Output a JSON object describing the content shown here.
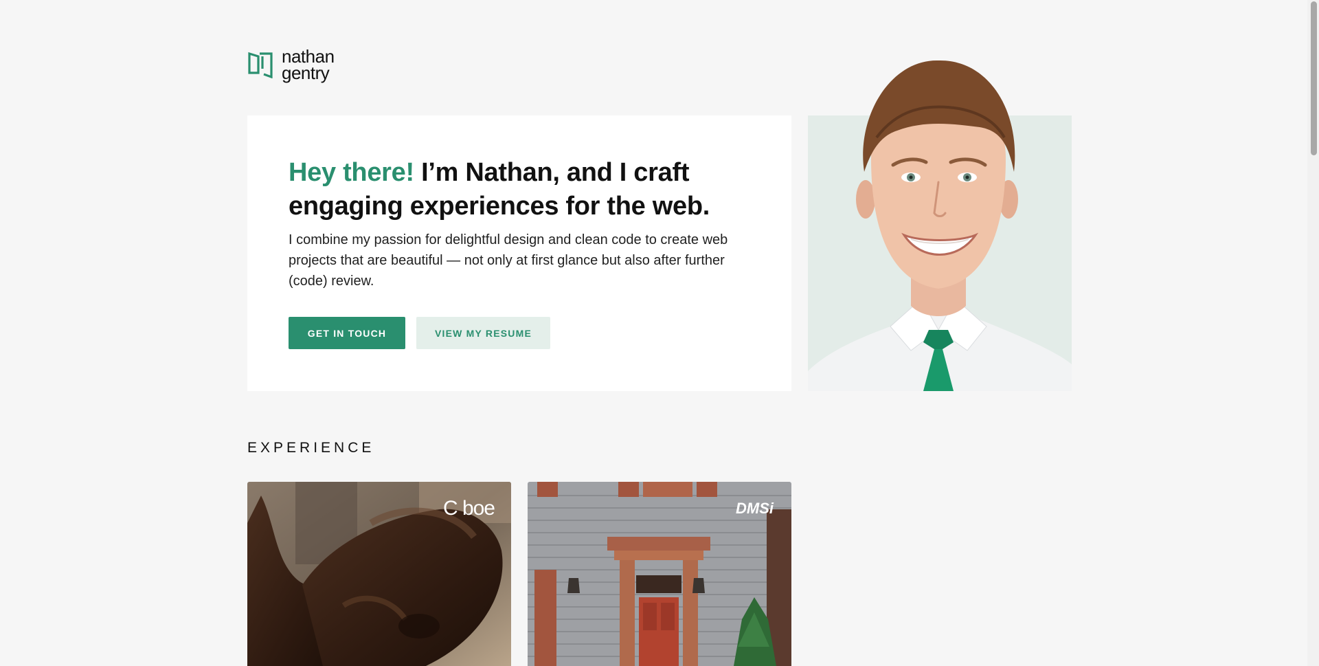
{
  "brand": {
    "name_line1": "nathan",
    "name_line2": "gentry",
    "accent_color": "#2a8f6f"
  },
  "hero": {
    "heading_accent": "Hey there!",
    "heading_rest": " I’m Nathan, and I craft engaging experiences for the web.",
    "body": "I combine my passion for delightful design and clean code to create web projects that are beautiful — not only at first glance but also after further (code) review.",
    "primary_button": "GET IN TOUCH",
    "secondary_button": "VIEW MY RESUME",
    "portrait_icon": "person-portrait"
  },
  "experience": {
    "title": "EXPERIENCE",
    "cards": [
      {
        "logo": "C boe",
        "image_icon": "bull-statue-image"
      },
      {
        "logo": "DMSi",
        "image_icon": "house-door-image"
      }
    ]
  }
}
